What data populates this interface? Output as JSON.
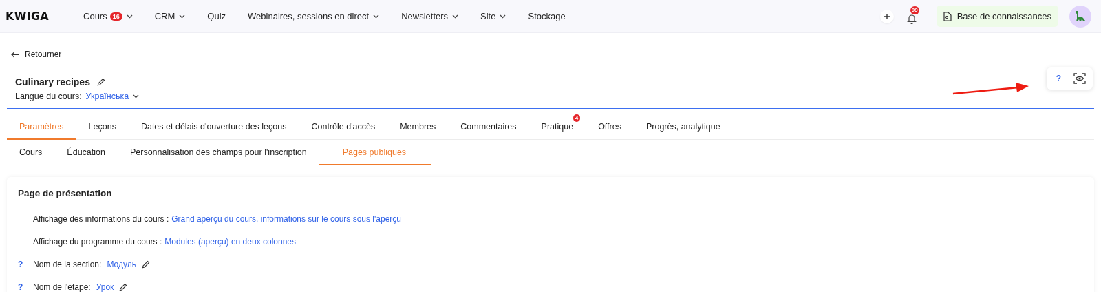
{
  "header": {
    "logo": "KWIGA",
    "nav": [
      {
        "label": "Cours",
        "badge": "16",
        "dropdown": true
      },
      {
        "label": "CRM",
        "dropdown": true
      },
      {
        "label": "Quiz",
        "dropdown": false
      },
      {
        "label": "Webinaires, sessions en direct",
        "dropdown": true
      },
      {
        "label": "Newsletters",
        "dropdown": true
      },
      {
        "label": "Site",
        "dropdown": true
      },
      {
        "label": "Stockage",
        "dropdown": false
      }
    ],
    "notification_badge": "99",
    "knowledge_base": "Base de connaissances"
  },
  "back_link": "Retourner",
  "course": {
    "title": "Culinary recipes",
    "language_label": "Langue du cours:",
    "language": "Українська"
  },
  "help_button": "?",
  "tabs": [
    {
      "label": "Paramètres",
      "selected": true
    },
    {
      "label": "Leçons",
      "selected": false
    },
    {
      "label": "Dates et délais d'ouverture des leçons",
      "selected": false
    },
    {
      "label": "Contrôle d'accès",
      "selected": false
    },
    {
      "label": "Membres",
      "selected": false
    },
    {
      "label": "Commentaires",
      "selected": false
    },
    {
      "label": "Pratique",
      "selected": false,
      "badge": "4"
    },
    {
      "label": "Offres",
      "selected": false
    },
    {
      "label": "Progrès, analytique",
      "selected": false
    }
  ],
  "subtabs": [
    {
      "label": "Cours",
      "selected": false
    },
    {
      "label": "Éducation",
      "selected": false
    },
    {
      "label": "Personnalisation des champs pour l'inscription",
      "selected": false
    },
    {
      "label": "Pages publiques",
      "selected": true
    }
  ],
  "card": {
    "title": "Page de présentation",
    "rows": [
      {
        "kind": "display",
        "label": "Affichage des informations du cours :",
        "value": "Grand aperçu du cours, informations sur le cours sous l'aperçu"
      },
      {
        "kind": "display",
        "label": "Affichage du programme du cours :",
        "value": "Modules (aperçu) en deux colonnes"
      },
      {
        "kind": "editable",
        "help": "?",
        "label": "Nom de la section:",
        "value": "Модуль"
      },
      {
        "kind": "editable",
        "help": "?",
        "label": "Nom de l'étape:",
        "value": "Урок"
      }
    ]
  }
}
